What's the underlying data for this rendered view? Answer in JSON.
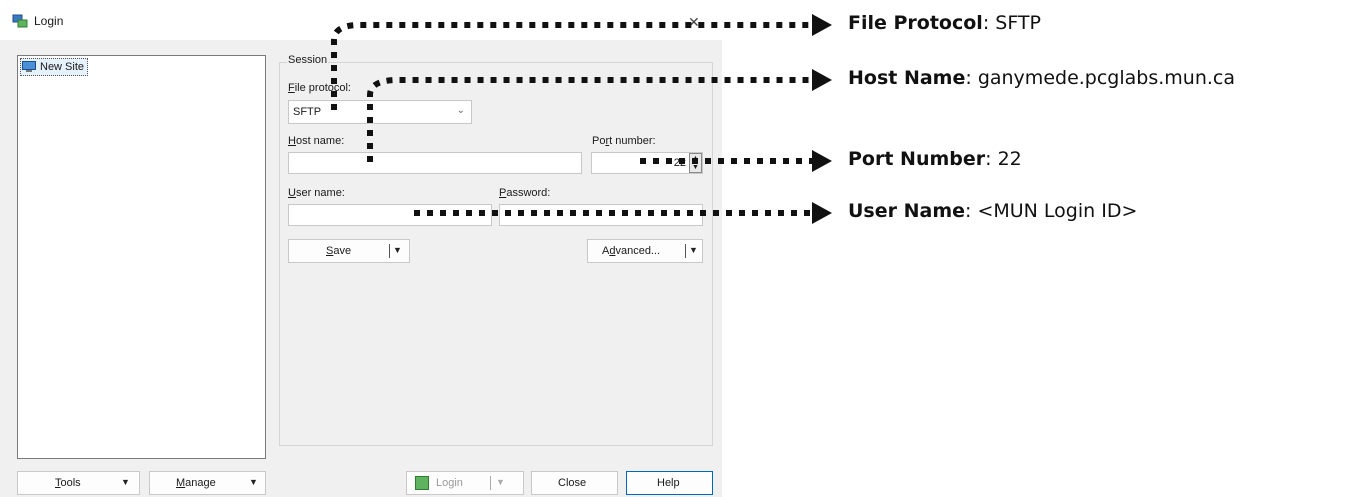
{
  "window": {
    "title": "Login",
    "close_glyph": "✕"
  },
  "site_tree": {
    "items": [
      {
        "label": "New Site",
        "icon": "monitor-site-icon"
      }
    ]
  },
  "session": {
    "legend": "Session",
    "file_protocol": {
      "label_accel": "F",
      "label_rest": "ile protocol:",
      "value": "SFTP"
    },
    "host_name": {
      "label_accel": "H",
      "label_rest": "ost name:",
      "value": ""
    },
    "port_number": {
      "label_pre": "Po",
      "label_accel": "r",
      "label_rest": "t number:",
      "value": "22"
    },
    "user_name": {
      "label_accel": "U",
      "label_rest": "ser name:",
      "value": ""
    },
    "password": {
      "label_accel": "P",
      "label_rest": "assword:",
      "value": ""
    }
  },
  "buttons": {
    "save": {
      "accel": "S",
      "rest": "ave"
    },
    "advanced": {
      "pre": "A",
      "accel": "d",
      "rest": "vanced..."
    },
    "tools": {
      "accel": "T",
      "rest": "ools"
    },
    "manage": {
      "accel": "M",
      "rest": "anage"
    },
    "login": "Login",
    "close": "Close",
    "help": "Help"
  },
  "annotations": [
    {
      "key": "File Protocol",
      "value": ": SFTP"
    },
    {
      "key": "Host Name",
      "value": ": ganymede.pcglabs.mun.ca"
    },
    {
      "key": "Port Number",
      "value": ": 22"
    },
    {
      "key": "User Name",
      "value": ": <MUN Login ID>"
    }
  ]
}
